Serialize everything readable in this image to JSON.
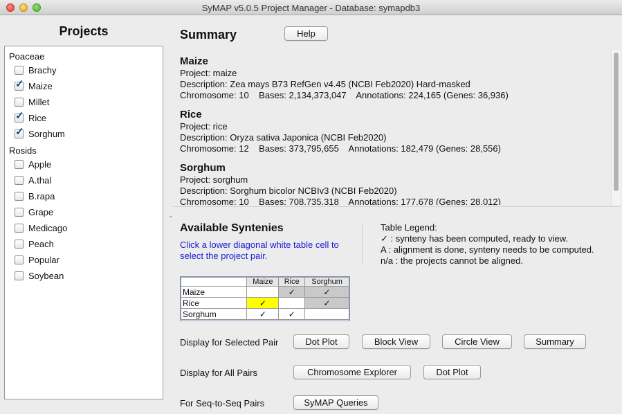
{
  "window": {
    "title": "SyMAP v5.0.5 Project Manager - Database: symapdb3"
  },
  "projects_panel": {
    "heading": "Projects",
    "groups": [
      {
        "label": "Poaceae",
        "items": [
          {
            "label": "Brachy",
            "checked": false
          },
          {
            "label": "Maize",
            "checked": true
          },
          {
            "label": "Millet",
            "checked": false
          },
          {
            "label": "Rice",
            "checked": true
          },
          {
            "label": "Sorghum",
            "checked": true
          }
        ]
      },
      {
        "label": "Rosids",
        "items": [
          {
            "label": "Apple",
            "checked": false
          },
          {
            "label": "A.thal",
            "checked": false
          },
          {
            "label": "B.rapa",
            "checked": false
          },
          {
            "label": "Grape",
            "checked": false
          },
          {
            "label": "Medicago",
            "checked": false
          },
          {
            "label": "Peach",
            "checked": false
          },
          {
            "label": "Popular",
            "checked": false
          },
          {
            "label": "Soybean",
            "checked": false
          }
        ]
      }
    ]
  },
  "summary": {
    "heading": "Summary",
    "help_label": "Help",
    "projects": [
      {
        "name": "Maize",
        "project": "Project: maize",
        "description": "Description: Zea mays B73 RefGen v4.45 (NCBI Feb2020) Hard-masked",
        "stats": "Chromosome: 10    Bases: 2,134,373,047    Annotations: 224,165 (Genes: 36,936)"
      },
      {
        "name": "Rice",
        "project": "Project: rice",
        "description": "Description: Oryza sativa Japonica (NCBI Feb2020)",
        "stats": "Chromosome: 12    Bases: 373,795,655    Annotations: 182,479 (Genes: 28,556)"
      },
      {
        "name": "Sorghum",
        "project": "Project: sorghum",
        "description": "Description: Sorghum bicolor NCBIv3 (NCBI Feb2020)",
        "stats": "Chromosome: 10    Bases: 708,735,318    Annotations: 177,678 (Genes: 28,012)"
      }
    ]
  },
  "syntenies": {
    "heading": "Available Syntenies",
    "instruction": "Click a lower diagonal white table cell to select the project pair.",
    "legend": {
      "title": "Table Legend:",
      "lines": [
        "✓ : synteny has been computed, ready to view.",
        "A : alignment is done, synteny needs to be computed.",
        "n/a : the projects cannot be aligned."
      ]
    },
    "table": {
      "columns": [
        "Maize",
        "Rice",
        "Sorghum"
      ],
      "rows": [
        {
          "label": "Maize",
          "cells": [
            "",
            "✓",
            "✓"
          ]
        },
        {
          "label": "Rice",
          "cells": [
            "✓",
            "",
            "✓"
          ]
        },
        {
          "label": "Sorghum",
          "cells": [
            "✓",
            "✓",
            ""
          ]
        }
      ]
    }
  },
  "actions": {
    "selected_pair": {
      "label": "Display for Selected Pair",
      "buttons": [
        "Dot Plot",
        "Block View",
        "Circle View",
        "Summary"
      ]
    },
    "all_pairs": {
      "label": "Display for All Pairs",
      "buttons": [
        "Chromosome Explorer",
        "Dot Plot"
      ]
    },
    "seq_pairs": {
      "label": "For Seq-to-Seq Pairs",
      "buttons": [
        "SyMAP Queries"
      ]
    }
  },
  "colors": {
    "highlight_cell": "#ffff00",
    "computed_cell": "#c9c9c9",
    "instruction_text": "#1a1ad8"
  }
}
